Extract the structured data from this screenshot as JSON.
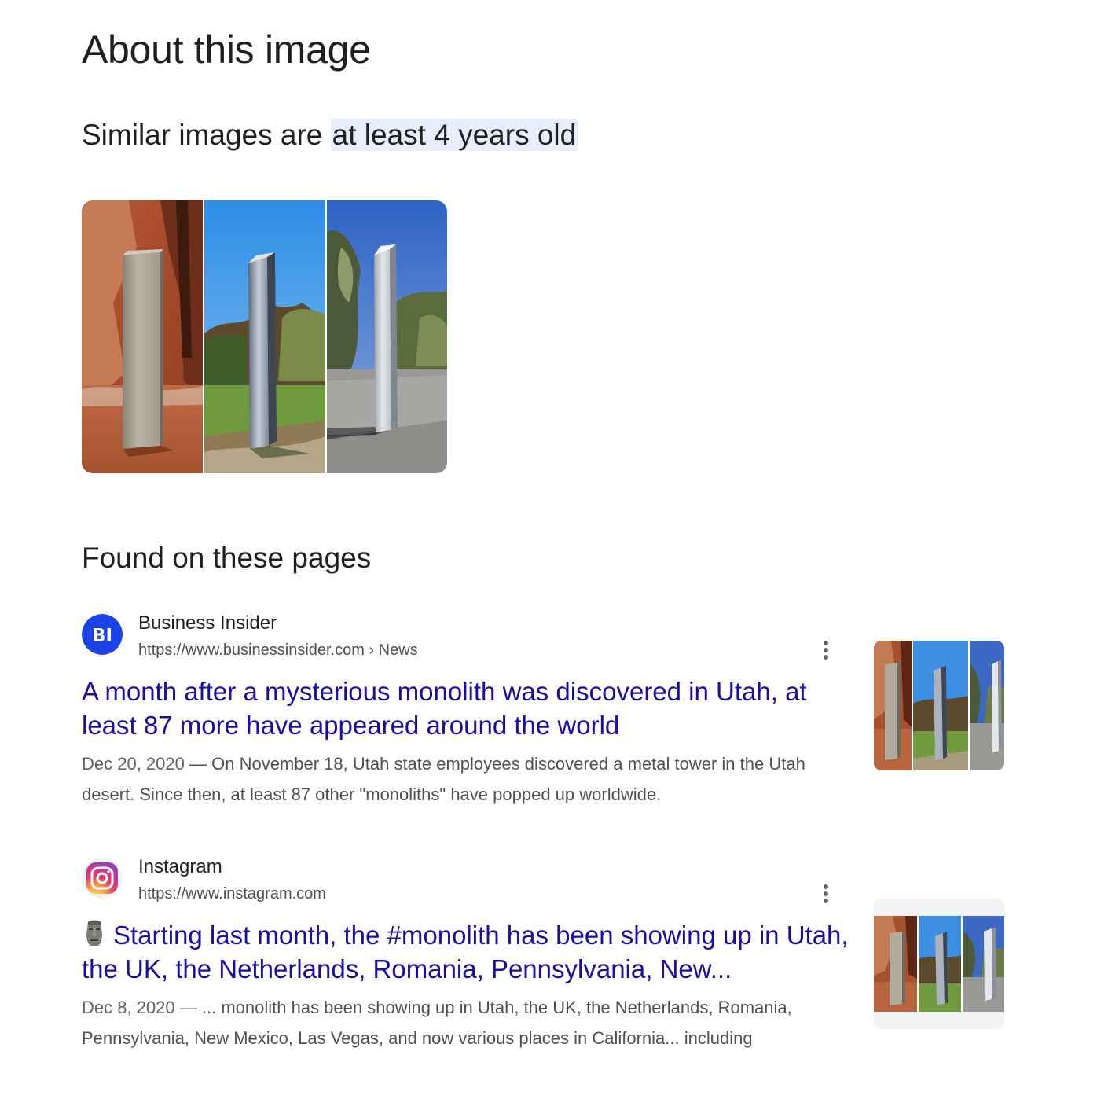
{
  "page": {
    "title": "About this image",
    "age_prefix": "Similar images are",
    "age_highlight": "at least 4 years old",
    "section_title": "Found on these pages"
  },
  "results": [
    {
      "site_name": "Business Insider",
      "favicon_text": "BI",
      "url": "https://www.businessinsider.com › News",
      "title": "A month after a mysterious monolith was discovered in Utah, at least 87 more have appeared around the world",
      "date": "Dec 20, 2020",
      "separator": " — ",
      "snippet": "On November 18, Utah state employees discovered a metal tower in the Utah desert. Since then, at least 87 other \"monoliths\" have popped up worldwide.",
      "favicon_color": "#1a44e8"
    },
    {
      "site_name": "Instagram",
      "url": "https://www.instagram.com",
      "title_emoji": "🗿",
      "title": "Starting last month, the #monolith has been showing up in Utah, the UK, the Netherlands, Romania, Pennsylvania, New...",
      "date": "Dec 8, 2020",
      "separator": " — ",
      "snippet": "... monolith has been showing up in Utah, the UK, the Netherlands, Romania, Pennsylvania, New Mexico, Las Vegas, and now various places in California... including"
    }
  ],
  "icons": {
    "more": "more-vert-icon",
    "instagram": "instagram-logo-icon",
    "emoji": "moai-icon"
  },
  "colors": {
    "link": "#1a0dab",
    "highlight": "#e8edfb",
    "muted": "#4d5156"
  }
}
